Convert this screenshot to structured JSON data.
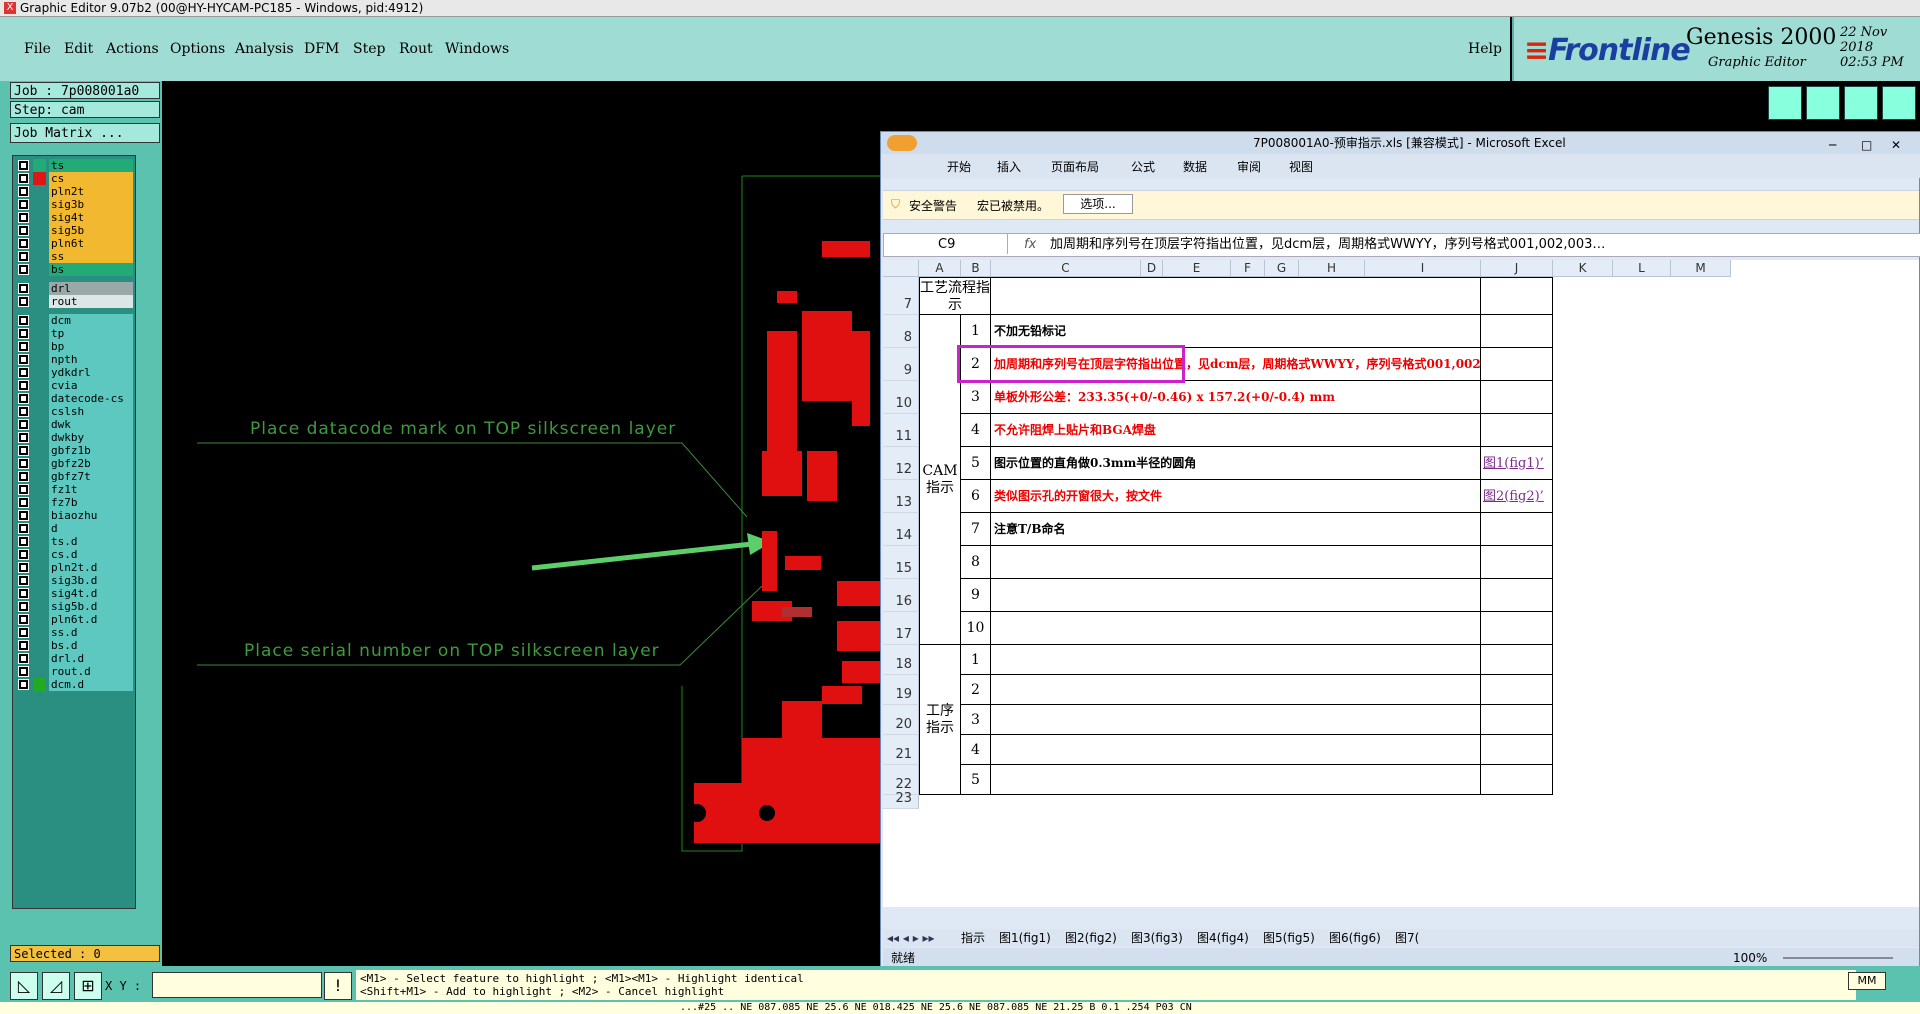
{
  "window": {
    "title": "Graphic Editor 9.07b2 (00@HY-HYCAM-PC185 - Windows, pid:4912)"
  },
  "menu": {
    "items": [
      {
        "label": "File"
      },
      {
        "label": "Edit"
      },
      {
        "label": "Actions"
      },
      {
        "label": "Options"
      },
      {
        "label": "Analysis"
      },
      {
        "label": "DFM"
      },
      {
        "label": "Step"
      },
      {
        "label": "Rout"
      },
      {
        "label": "Windows"
      }
    ],
    "help": "Help"
  },
  "brand": {
    "logo": "Frontline",
    "product": "Genesis 2000",
    "subtitle": "Graphic Editor",
    "date": "22 Nov 2018",
    "time": "02:53 PM"
  },
  "job": {
    "job_label": "Job : 7p008001a0",
    "step_label": "Step: cam",
    "matrix_button": "Job Matrix ..."
  },
  "layers": [
    {
      "name": "ts",
      "color": "#22aa77",
      "swatch": "#22aa77"
    },
    {
      "name": "cs",
      "color": "#f2b830",
      "swatch": "#e01515"
    },
    {
      "name": "pln2t",
      "color": "#f2b830",
      "swatch": ""
    },
    {
      "name": "sig3b",
      "color": "#f2b830",
      "swatch": ""
    },
    {
      "name": "sig4t",
      "color": "#f2b830",
      "swatch": ""
    },
    {
      "name": "sig5b",
      "color": "#f2b830",
      "swatch": ""
    },
    {
      "name": "pln6t",
      "color": "#f2b830",
      "swatch": ""
    },
    {
      "name": "ss",
      "color": "#f2b830",
      "swatch": ""
    },
    {
      "name": "bs",
      "color": "#22aa77",
      "swatch": ""
    },
    {
      "name": "drl",
      "color": "#9aa8a8",
      "swatch": ""
    },
    {
      "name": "rout",
      "color": "#dde6e6",
      "swatch": ""
    },
    {
      "name": "dcm",
      "color": "#5cc8c0",
      "swatch": ""
    },
    {
      "name": "tp",
      "color": "#5cc8c0",
      "swatch": ""
    },
    {
      "name": "bp",
      "color": "#5cc8c0",
      "swatch": ""
    },
    {
      "name": "npth",
      "color": "#5cc8c0",
      "swatch": ""
    },
    {
      "name": "ydkdrl",
      "color": "#5cc8c0",
      "swatch": ""
    },
    {
      "name": "cvia",
      "color": "#5cc8c0",
      "swatch": ""
    },
    {
      "name": "datecode-cs",
      "color": "#5cc8c0",
      "swatch": ""
    },
    {
      "name": "cslsh",
      "color": "#5cc8c0",
      "swatch": ""
    },
    {
      "name": "dwk",
      "color": "#5cc8c0",
      "swatch": ""
    },
    {
      "name": "dwkby",
      "color": "#5cc8c0",
      "swatch": ""
    },
    {
      "name": "gbfz1b",
      "color": "#5cc8c0",
      "swatch": ""
    },
    {
      "name": "gbfz2b",
      "color": "#5cc8c0",
      "swatch": ""
    },
    {
      "name": "gbfz7t",
      "color": "#5cc8c0",
      "swatch": ""
    },
    {
      "name": "fz1t",
      "color": "#5cc8c0",
      "swatch": ""
    },
    {
      "name": "fz7b",
      "color": "#5cc8c0",
      "swatch": ""
    },
    {
      "name": "biaozhu",
      "color": "#5cc8c0",
      "swatch": ""
    },
    {
      "name": "d",
      "color": "#5cc8c0",
      "swatch": ""
    },
    {
      "name": "ts.d",
      "color": "#5cc8c0",
      "swatch": ""
    },
    {
      "name": "cs.d",
      "color": "#5cc8c0",
      "swatch": ""
    },
    {
      "name": "pln2t.d",
      "color": "#5cc8c0",
      "swatch": ""
    },
    {
      "name": "sig3b.d",
      "color": "#5cc8c0",
      "swatch": ""
    },
    {
      "name": "sig4t.d",
      "color": "#5cc8c0",
      "swatch": ""
    },
    {
      "name": "sig5b.d",
      "color": "#5cc8c0",
      "swatch": ""
    },
    {
      "name": "pln6t.d",
      "color": "#5cc8c0",
      "swatch": ""
    },
    {
      "name": "ss.d",
      "color": "#5cc8c0",
      "swatch": ""
    },
    {
      "name": "bs.d",
      "color": "#5cc8c0",
      "swatch": ""
    },
    {
      "name": "drl.d",
      "color": "#5cc8c0",
      "swatch": ""
    },
    {
      "name": "rout.d",
      "color": "#5cc8c0",
      "swatch": ""
    },
    {
      "name": "dcm.d",
      "color": "#5cc8c0",
      "swatch": "#22aa22"
    }
  ],
  "selected": "Selected : 0",
  "canvas": {
    "annotation_top": "Place datacode mark on TOP silkscreen layer",
    "annotation_bottom": "Place serial number on TOP silkscreen layer"
  },
  "status": {
    "xy_label": "X Y :",
    "hint_line1": "<M1> - Select feature to highlight ; <M1><M1> - Highlight identical",
    "hint_line2": "<Shift+M1> - Add to highlight ; <M2> - Cancel highlight",
    "units": "MM",
    "coords": "...#25 ..  NE 087.085 NE 25.6 NE 018.425 NE 25.6 NE 087.085 NE 21.25 B 0.1 .254 P03 CN"
  },
  "excel": {
    "title": "7P008001A0-预审指示.xls [兼容模式] - Microsoft Excel",
    "ribbon_tabs": [
      "开始",
      "插入",
      "页面布局",
      "公式",
      "数据",
      "审阅",
      "视图"
    ],
    "security_title": "安全警告",
    "security_msg": "宏已被禁用。",
    "security_button": "选项...",
    "name_box": "C9",
    "fx": "fx",
    "formula": "加周期和序列号在顶层字符指出位置，见dcm层，周期格式WWYY，序列号格式001,002,003…",
    "columns": [
      "A",
      "B",
      "C",
      "D",
      "E",
      "F",
      "G",
      "H",
      "I",
      "J",
      "K",
      "L",
      "M"
    ],
    "header_row": {
      "num": "7",
      "label": "工艺流程指示"
    },
    "groups": [
      {
        "label": "CAM指示"
      },
      {
        "label": "工序指示"
      }
    ],
    "rows": [
      {
        "rownum": "8",
        "idx": "1",
        "text": "不加无铅标记",
        "red": false,
        "link": ""
      },
      {
        "rownum": "9",
        "idx": "2",
        "text": "加周期和序列号在顶层字符指出位置，见dcm层，周期格式WWYY，序列号格式001,002,003…",
        "red": true,
        "link": ""
      },
      {
        "rownum": "10",
        "idx": "3",
        "text": "单板外形公差：233.35(+0/-0.46) x 157.2(+0/-0.4) mm",
        "red": true,
        "link": ""
      },
      {
        "rownum": "11",
        "idx": "4",
        "text": "不允许阻焊上贴片和BGA焊盘",
        "red": true,
        "link": ""
      },
      {
        "rownum": "12",
        "idx": "5",
        "text": "图示位置的直角做0.3mm半径的圆角",
        "red": false,
        "link": "图1(fig1)’"
      },
      {
        "rownum": "13",
        "idx": "6",
        "text": "类似图示孔的开窗很大，按文件",
        "red": true,
        "link": "图2(fig2)’"
      },
      {
        "rownum": "14",
        "idx": "7",
        "text": "注意T/B命名",
        "red": false,
        "link": ""
      },
      {
        "rownum": "15",
        "idx": "8",
        "text": "",
        "red": false,
        "link": ""
      },
      {
        "rownum": "16",
        "idx": "9",
        "text": "",
        "red": false,
        "link": ""
      },
      {
        "rownum": "17",
        "idx": "10",
        "text": "",
        "red": false,
        "link": ""
      },
      {
        "rownum": "18",
        "idx": "1",
        "text": "",
        "red": false,
        "link": ""
      },
      {
        "rownum": "19",
        "idx": "2",
        "text": "",
        "red": false,
        "link": ""
      },
      {
        "rownum": "20",
        "idx": "3",
        "text": "",
        "red": false,
        "link": ""
      },
      {
        "rownum": "21",
        "idx": "4",
        "text": "",
        "red": false,
        "link": ""
      },
      {
        "rownum": "22",
        "idx": "5",
        "text": "",
        "red": false,
        "link": ""
      },
      {
        "rownum": "23",
        "idx": "",
        "text": "",
        "red": false,
        "link": ""
      }
    ],
    "sheet_tabs": [
      "指示",
      "图1(fig1)",
      "图2(fig2)",
      "图3(fig3)",
      "图4(fig4)",
      "图5(fig5)",
      "图6(fig6)",
      "图7("
    ],
    "status_ready": "就绪",
    "zoom": "100%",
    "highlight_color": "#cc22cc"
  }
}
